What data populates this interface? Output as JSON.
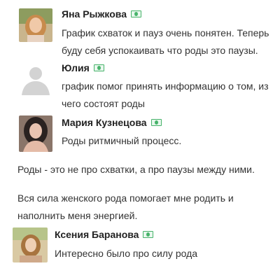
{
  "comments": [
    {
      "name": "Яна Рыжкова",
      "text_lines": [
        "График схваток и пауз очень понятен. Теперь",
        "буду себя успокаивать что роды это паузы."
      ]
    },
    {
      "name": "Юлия",
      "text_lines": [
        "график помог принять информацию о том, из",
        "чего состоят роды"
      ]
    },
    {
      "name": "Мария Кузнецова",
      "text_lines": [
        "Роды ритмичный процесс."
      ],
      "extra_paragraphs": [
        [
          "Роды - это не про схватки, а про паузы между ними."
        ],
        [
          "Вся сила женского рода помогает мне родить и",
          "наполнить меня энергией."
        ]
      ]
    },
    {
      "name": "Ксения Баранова",
      "text_lines": [
        "Интересно было про силу рода"
      ]
    }
  ],
  "colors": {
    "badge": "#47b36a",
    "text": "#333333",
    "name": "#222222",
    "avatar_placeholder": "#d7d7d7"
  }
}
